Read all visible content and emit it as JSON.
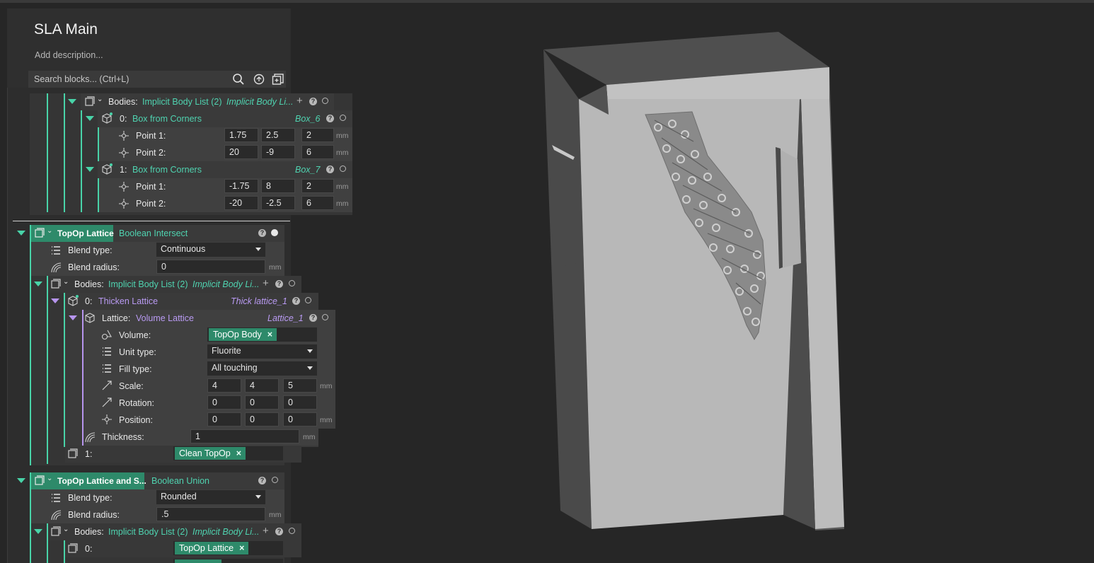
{
  "header": {
    "title": "SLA Main",
    "description_placeholder": "Add description...",
    "search_placeholder": "Search blocks... (Ctrl+L)"
  },
  "units": {
    "mm": "mm"
  },
  "upper_bodies": {
    "label": "Bodies:",
    "type": "Implicit Body List (2)",
    "type_alt": "Implicit Body Li...",
    "items": [
      {
        "index": "0:",
        "type": "Box from Corners",
        "name": "Box_6",
        "p1_label": "Point 1:",
        "p1": [
          "1.75",
          "2.5",
          "2"
        ],
        "p2_label": "Point 2:",
        "p2": [
          "20",
          "-9",
          "6"
        ]
      },
      {
        "index": "1:",
        "type": "Box from Corners",
        "name": "Box_7",
        "p1_label": "Point 1:",
        "p1": [
          "-1.75",
          "8",
          "2"
        ],
        "p2_label": "Point 2:",
        "p2": [
          "-20",
          "-2.5",
          "6"
        ]
      }
    ]
  },
  "topop_lattice": {
    "name": "TopOp Lattice",
    "type": "Boolean Intersect",
    "blend_type_label": "Blend type:",
    "blend_type": "Continuous",
    "blend_radius_label": "Blend radius:",
    "blend_radius": "0",
    "bodies_label": "Bodies:",
    "bodies_type": "Implicit Body List (2)",
    "bodies_type_alt": "Implicit Body Li...",
    "body0_index": "0:",
    "body0_type": "Thicken Lattice",
    "body0_name": "Thick lattice_1",
    "lattice_label": "Lattice:",
    "lattice_type": "Volume Lattice",
    "lattice_name": "Lattice_1",
    "volume_label": "Volume:",
    "volume_value": "TopOp Body",
    "unit_type_label": "Unit type:",
    "unit_type": "Fluorite",
    "fill_type_label": "Fill type:",
    "fill_type": "All touching",
    "scale_label": "Scale:",
    "scale": [
      "4",
      "4",
      "5"
    ],
    "rotation_label": "Rotation:",
    "rotation": [
      "0",
      "0",
      "0"
    ],
    "position_label": "Position:",
    "position": [
      "0",
      "0",
      "0"
    ],
    "thickness_label": "Thickness:",
    "thickness": "1",
    "body1_index": "1:",
    "body1_value": "Clean TopOp"
  },
  "union_block": {
    "name": "TopOp Lattice and S...",
    "type": "Boolean Union",
    "blend_type_label": "Blend type:",
    "blend_type": "Rounded",
    "blend_radius_label": "Blend radius:",
    "blend_radius": ".5",
    "bodies_label": "Bodies:",
    "bodies_type": "Implicit Body List (2)",
    "bodies_type_alt": "Implicit Body Li...",
    "body0_index": "0:",
    "body0_value": "TopOp Lattice"
  },
  "colors": {
    "accent": "#48d3a8",
    "lattice_accent": "#b795ee",
    "chip": "#2e8a6a",
    "background": "#262626"
  }
}
